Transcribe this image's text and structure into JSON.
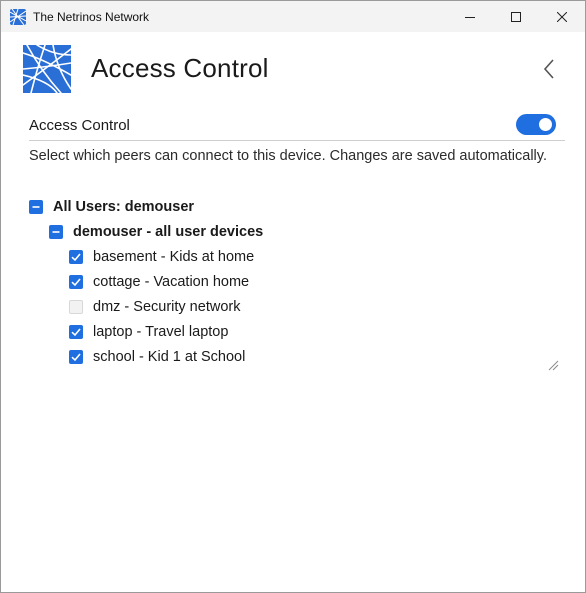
{
  "window": {
    "title": "The Netrinos Network",
    "app_icon": "netrinos-logo-icon",
    "controls": [
      "minimize-icon",
      "maximize-icon",
      "close-icon"
    ]
  },
  "header": {
    "title": "Access Control",
    "logo": "netrinos-logo-icon",
    "back_icon": "chevron-left-icon"
  },
  "access_control": {
    "label": "Access Control",
    "toggle_on": true,
    "accent": "#1f6fe0"
  },
  "description": "Select which peers can connect to this device. Changes are saved automatically.",
  "tree": {
    "root": {
      "label": "All Users: demouser",
      "state": "partial"
    },
    "group": {
      "label": "demouser - all user devices",
      "state": "partial"
    },
    "devices": [
      {
        "label": "basement - Kids at home",
        "checked": true
      },
      {
        "label": "cottage - Vacation home",
        "checked": true
      },
      {
        "label": "dmz - Security network",
        "checked": false
      },
      {
        "label": "laptop - Travel laptop",
        "checked": true
      },
      {
        "label": "school - Kid 1 at School",
        "checked": true
      }
    ]
  }
}
